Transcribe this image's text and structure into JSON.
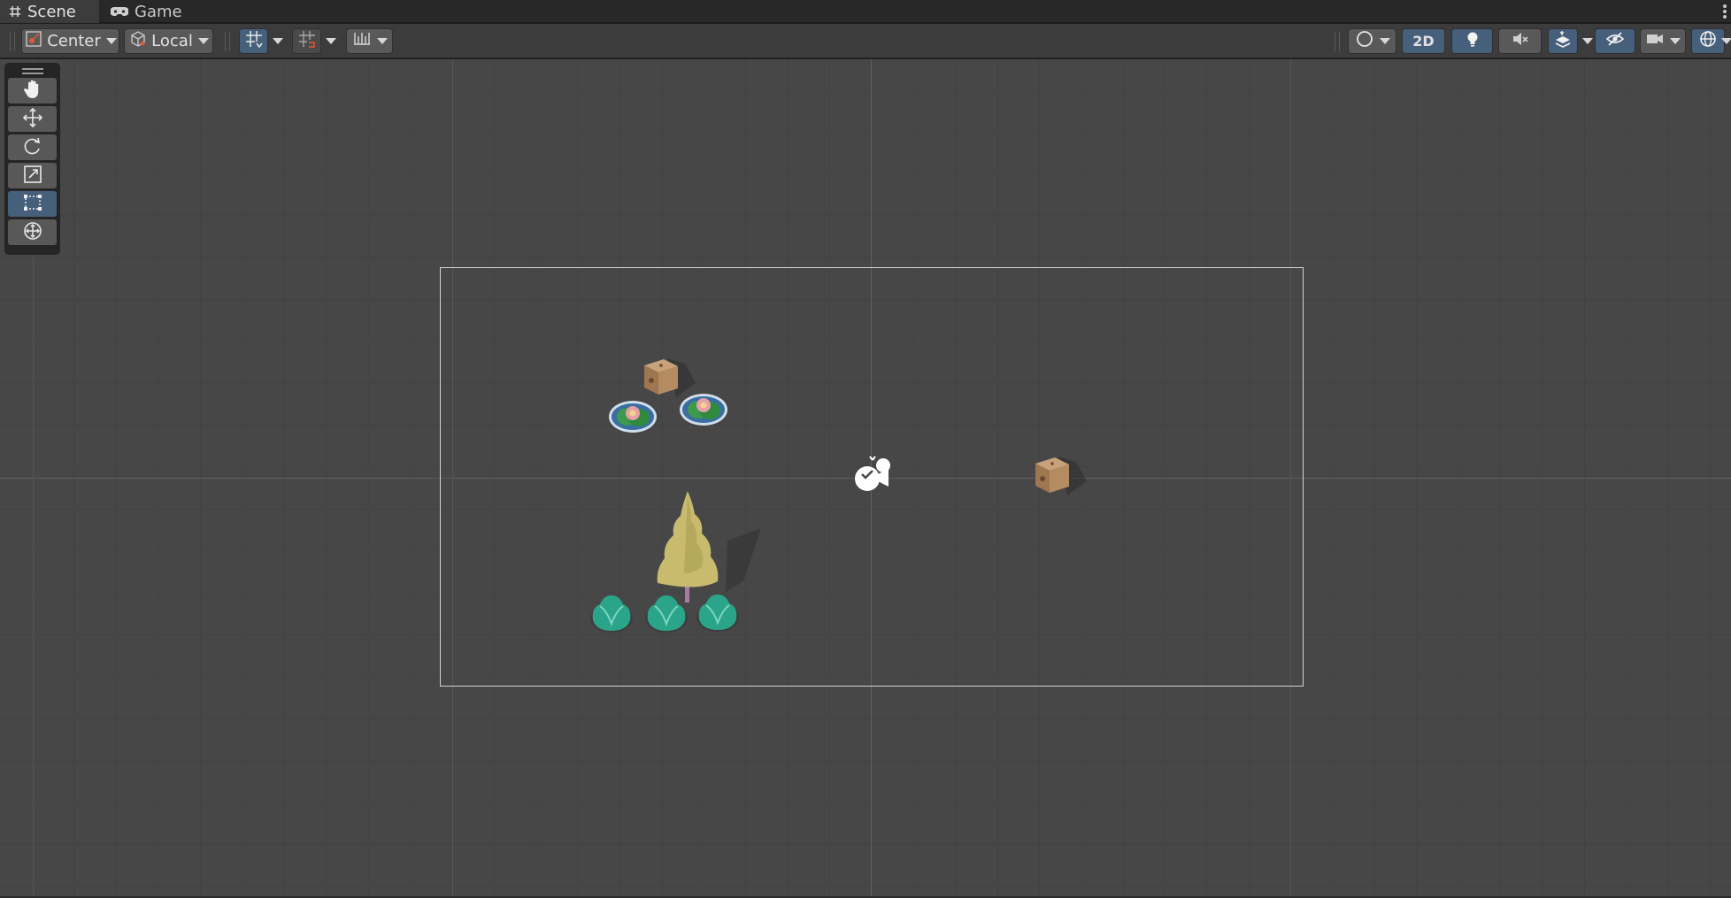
{
  "tabs": [
    {
      "label": "Scene",
      "icon": "grid-hash-icon",
      "active": true
    },
    {
      "label": "Game",
      "icon": "gamepad-icon",
      "active": false
    }
  ],
  "toolbar": {
    "pivot_mode": "Center",
    "pivot_rotation": "Local",
    "toggle_2d": "2D"
  },
  "tools": [
    {
      "name": "hand-tool",
      "icon": "hand-icon",
      "selected": false
    },
    {
      "name": "move-tool",
      "icon": "move-arrows-icon",
      "selected": false
    },
    {
      "name": "rotate-tool",
      "icon": "rotate-icon",
      "selected": false
    },
    {
      "name": "scale-tool",
      "icon": "scale-icon",
      "selected": false
    },
    {
      "name": "rect-tool",
      "icon": "rect-transform-icon",
      "selected": true
    },
    {
      "name": "transform-tool",
      "icon": "transform-icon",
      "selected": false
    }
  ],
  "colors": {
    "scene_bg": "#474747",
    "toolbar_bg": "#3c3c3c",
    "button_bg": "#595959",
    "button_active": "#46607c",
    "camera_frame": "#d4d4d4"
  }
}
